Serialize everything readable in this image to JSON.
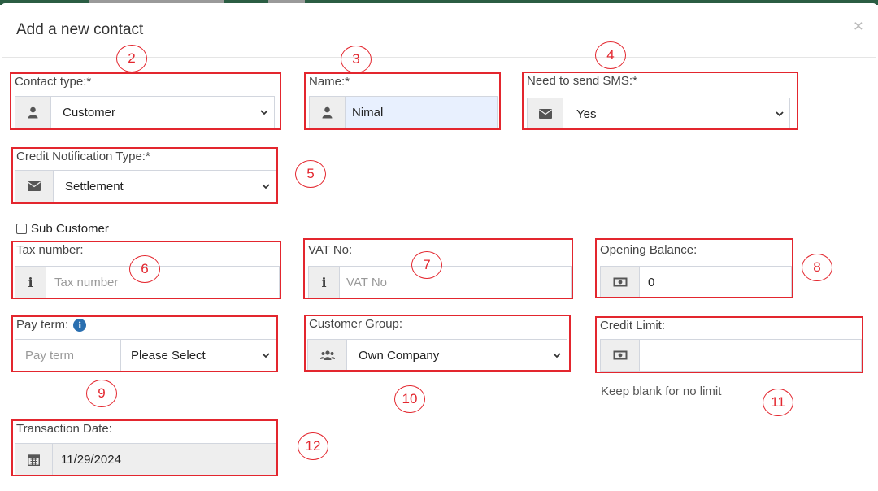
{
  "modal": {
    "title": "Add a new contact",
    "close": "×"
  },
  "fields": {
    "contact_type": {
      "label": "Contact type:*",
      "value": "Customer",
      "icon": "user-icon"
    },
    "name": {
      "label": "Name:*",
      "value": "Nimal",
      "icon": "user-icon"
    },
    "need_sms": {
      "label": "Need to send SMS:*",
      "value": "Yes",
      "icon": "envelope-icon"
    },
    "credit_notification": {
      "label": "Credit Notification Type:*",
      "value": "Settlement",
      "icon": "envelope-icon"
    },
    "sub_customer": {
      "label": "Sub Customer",
      "checked": false
    },
    "tax_number": {
      "label": "Tax number:",
      "placeholder": "Tax number",
      "icon": "info-icon"
    },
    "vat_no": {
      "label": "VAT No:",
      "placeholder": "VAT No",
      "icon": "info-icon"
    },
    "opening_balance": {
      "label": "Opening Balance:",
      "value": "0",
      "icon": "money-icon"
    },
    "pay_term": {
      "label": "Pay term:",
      "placeholder": "Pay term",
      "select_value": "Please Select"
    },
    "customer_group": {
      "label": "Customer Group:",
      "value": "Own Company",
      "icon": "users-icon"
    },
    "credit_limit": {
      "label": "Credit Limit:",
      "value": "",
      "hint": "Keep blank for no limit",
      "icon": "money-icon"
    },
    "transaction_date": {
      "label": "Transaction Date:",
      "value": "11/29/2024",
      "icon": "calendar-icon"
    }
  },
  "annotations": [
    "2",
    "3",
    "4",
    "5",
    "6",
    "7",
    "8",
    "9",
    "10",
    "11",
    "12"
  ],
  "colors": {
    "annotation": "#e3262e",
    "addon_bg": "#eeeeee",
    "autofill_bg": "#e8f0fe",
    "info_icon": "#2a6fb0"
  }
}
